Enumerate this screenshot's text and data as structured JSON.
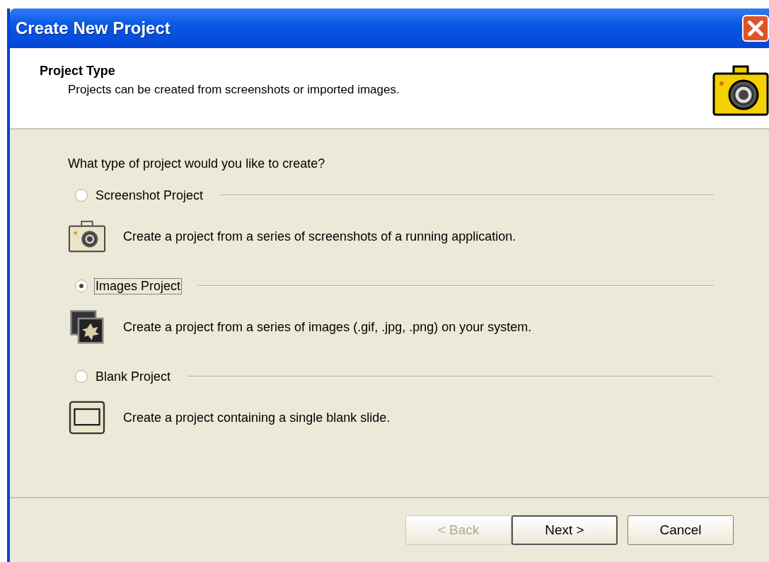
{
  "window": {
    "title": "Create New Project"
  },
  "header": {
    "title": "Project Type",
    "subtitle": "Projects can be created from screenshots or imported images."
  },
  "question": "What type of project would you like to create?",
  "options": [
    {
      "label": "Screenshot Project",
      "description": "Create a project from a series of screenshots of a running application.",
      "kind": "screenshot",
      "selected": false,
      "focused": false
    },
    {
      "label": "Images Project",
      "description": "Create a project from a series of images (.gif, .jpg, .png) on your system.",
      "kind": "images",
      "selected": true,
      "focused": true
    },
    {
      "label": "Blank Project",
      "description": "Create a project containing a single blank slide.",
      "kind": "blank",
      "selected": false,
      "focused": false
    }
  ],
  "buttons": [
    {
      "label": "< Back",
      "disabled": true,
      "default": false
    },
    {
      "label": "Next >",
      "disabled": false,
      "default": true
    },
    {
      "label": "Cancel",
      "disabled": false,
      "default": false
    }
  ]
}
